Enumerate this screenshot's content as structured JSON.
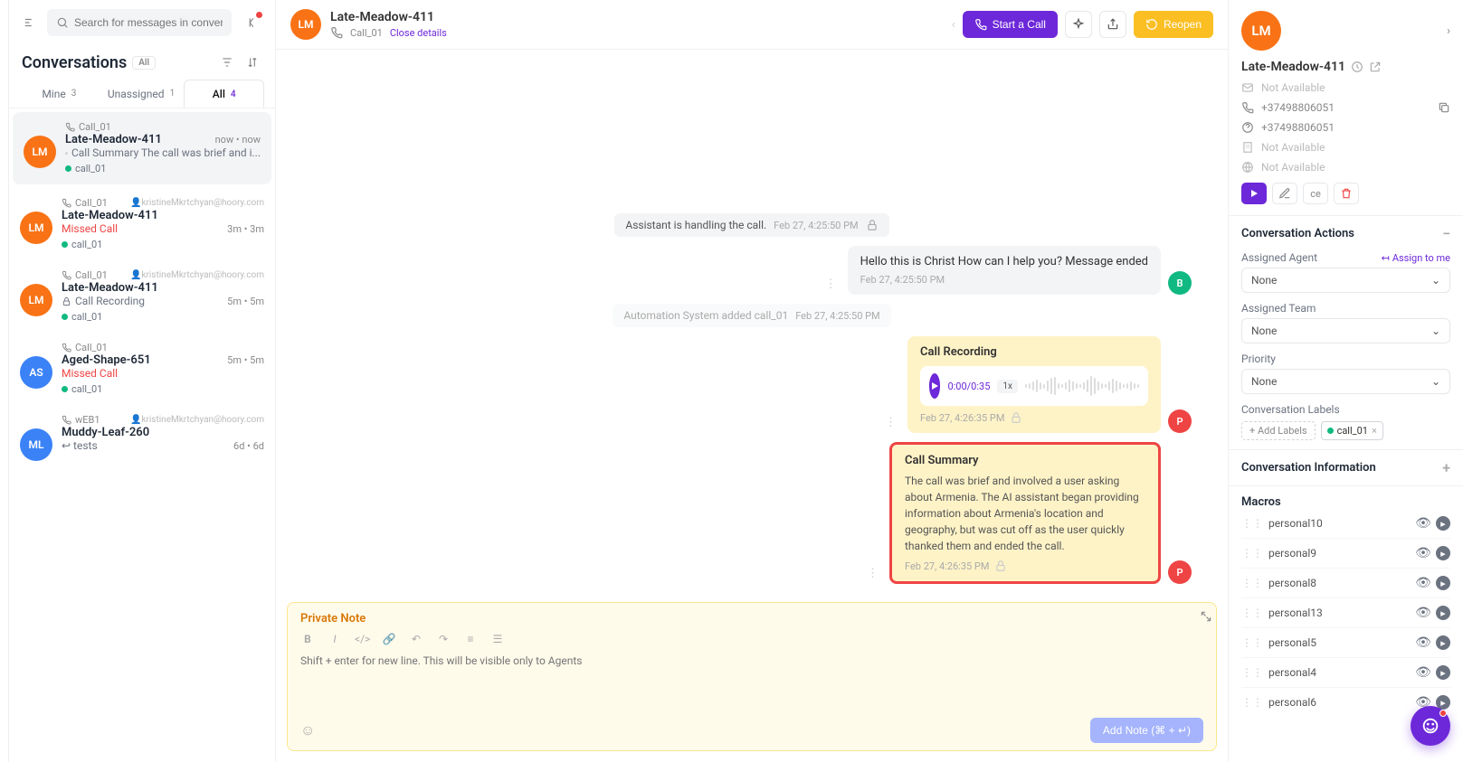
{
  "search": {
    "placeholder": "Search for messages in conversations"
  },
  "conversations": {
    "title": "Conversations",
    "badge": "All",
    "tabs": [
      {
        "label": "Mine",
        "count": "3"
      },
      {
        "label": "Unassigned",
        "count": "1"
      },
      {
        "label": "All",
        "count": "4"
      }
    ],
    "items": [
      {
        "avatar": "LM",
        "avatarColor": "#f97316",
        "source": "Call_01",
        "name": "Late-Meadow-411",
        "preview": "Call Summary The call was brief and i...",
        "previewIcon": "lock",
        "time": "now • now",
        "label": "call_01",
        "assignee": "",
        "missed": false
      },
      {
        "avatar": "LM",
        "avatarColor": "#f97316",
        "source": "Call_01",
        "name": "Late-Meadow-411",
        "preview": "Missed Call",
        "time": "3m • 3m",
        "label": "call_01",
        "assignee": "kristineMkrtchyan@hoory.com",
        "missed": true
      },
      {
        "avatar": "LM",
        "avatarColor": "#f97316",
        "source": "Call_01",
        "name": "Late-Meadow-411",
        "preview": "Call Recording",
        "previewIcon": "lock",
        "time": "5m • 5m",
        "label": "call_01",
        "assignee": "kristineMkrtchyan@hoory.com",
        "missed": false
      },
      {
        "avatar": "AS",
        "avatarColor": "#3b82f6",
        "source": "Call_01",
        "name": "Aged-Shape-651",
        "preview": "Missed Call",
        "time": "5m • 5m",
        "label": "call_01",
        "assignee": "",
        "missed": true
      },
      {
        "avatar": "ML",
        "avatarColor": "#3b82f6",
        "source": "wEB1",
        "name": "Muddy-Leaf-260",
        "preview": "tests",
        "previewIcon": "reply",
        "time": "6d • 6d",
        "label": "",
        "assignee": "kristineMkrtchyan@hoory.com",
        "missed": false
      }
    ]
  },
  "chat": {
    "header": {
      "avatar": "LM",
      "name": "Late-Meadow-411",
      "source": "Call_01",
      "close": "Close details"
    },
    "actions": {
      "start_call": "Start a Call",
      "reopen": "Reopen"
    },
    "messages": {
      "sys1": {
        "text": "Assistant is handling the call.",
        "ts": "Feb 27, 4:25:50 PM"
      },
      "agent1": {
        "text": "Hello this is Christ How can I help you? Message ended",
        "ts": "Feb 27, 4:25:50 PM",
        "avatar": "B",
        "avatarColor": "#10b981"
      },
      "sys2": {
        "text": "Automation System added call_01",
        "ts": "Feb 27, 4:25:50 PM"
      },
      "recording": {
        "title": "Call Recording",
        "time": "0:00/0:35",
        "speed": "1x",
        "ts": "Feb 27, 4:26:35 PM",
        "avatar": "P",
        "avatarColor": "#ef4444"
      },
      "summary": {
        "title": "Call Summary",
        "text": "The call was brief and involved a user asking about Armenia. The AI assistant began providing information about Armenia's location and geography, but was cut off as the user quickly thanked them and ended the call.",
        "ts": "Feb 27, 4:26:35 PM",
        "avatar": "P",
        "avatarColor": "#ef4444"
      }
    },
    "compose": {
      "tab": "Private Note",
      "placeholder": "Shift + enter for new line. This will be visible only to Agents",
      "button": "Add Note (⌘ + ↵)"
    }
  },
  "details": {
    "avatar": "LM",
    "name": "Late-Meadow-411",
    "email": "Not Available",
    "phone": "+37498806051",
    "phone2": "+37498806051",
    "company": "Not Available",
    "location": "Not Available",
    "actions_section": "Conversation Actions",
    "assigned_agent_label": "Assigned Agent",
    "assign_to_me": "Assign to me",
    "agent_value": "None",
    "assigned_team_label": "Assigned Team",
    "team_value": "None",
    "priority_label": "Priority",
    "priority_value": "None",
    "labels_label": "Conversation Labels",
    "add_labels": "+ Add Labels",
    "label_chip": "call_01",
    "info_section": "Conversation Information",
    "macros_section": "Macros",
    "macros": [
      "personal10",
      "personal9",
      "personal8",
      "personal13",
      "personal5",
      "personal4",
      "personal6"
    ]
  }
}
